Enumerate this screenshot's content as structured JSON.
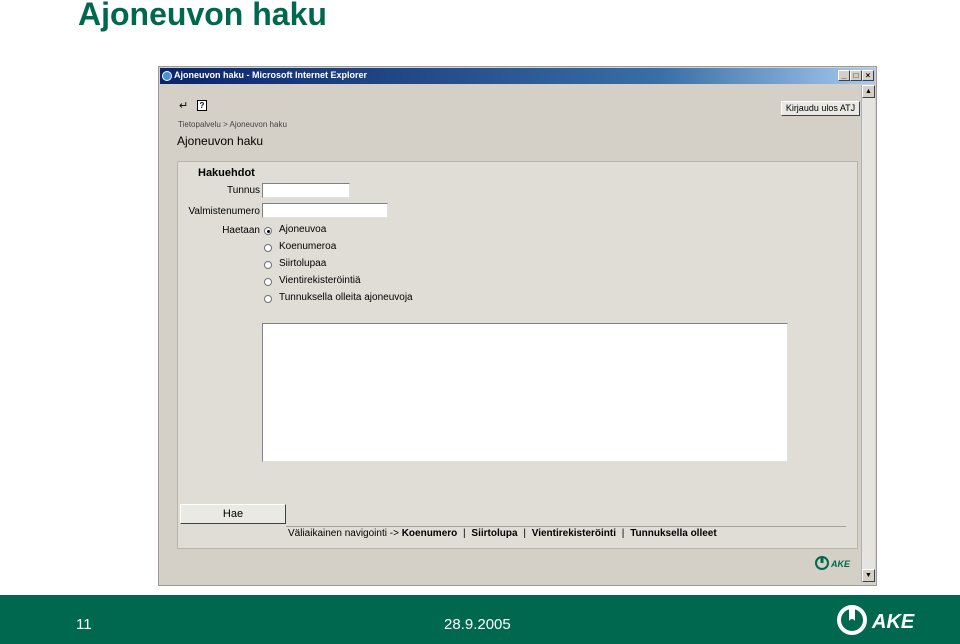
{
  "slide": {
    "title": "Ajoneuvon haku",
    "number": "11",
    "date": "28.9.2005",
    "logo_text": "AKE",
    "colors": {
      "brand": "#00684f",
      "footer_bg": "#00684f"
    }
  },
  "window": {
    "title": "Ajoneuvon haku - Microsoft Internet Explorer",
    "controls": {
      "minimize": "_",
      "maximize": "□",
      "close": "×"
    }
  },
  "toolbar": {
    "back_icon": "back-arrow-icon",
    "help_icon": "help-icon",
    "help_glyph": "?",
    "logout_label": "Kirjaudu ulos ATJ"
  },
  "breadcrumb": "Tietopalvelu > Ajoneuvon haku",
  "page_heading": "Ajoneuvon haku",
  "form": {
    "section_title": "Hakuehdot",
    "tunnus_label": "Tunnus",
    "tunnus_value": "",
    "valmistenumero_label": "Valmistenumero",
    "valmistenumero_value": "",
    "haetaan_label": "Haetaan",
    "search_types": [
      {
        "label": "Ajoneuvoa",
        "checked": true
      },
      {
        "label": "Koenumeroa",
        "checked": false
      },
      {
        "label": "Siirtolupaa",
        "checked": false
      },
      {
        "label": "Vientirekisteröintiä",
        "checked": false
      },
      {
        "label": "Tunnuksella olleita ajoneuvoja",
        "checked": false
      }
    ],
    "submit_label": "Hae"
  },
  "navigation": {
    "prefix": "Väliaikainen navigointi ->",
    "links": [
      "Koenumero",
      "Siirtolupa",
      "Vientirekisteröinti",
      "Tunnuksella olleet"
    ],
    "separator": "|"
  },
  "inner_logo_text": "AKE"
}
